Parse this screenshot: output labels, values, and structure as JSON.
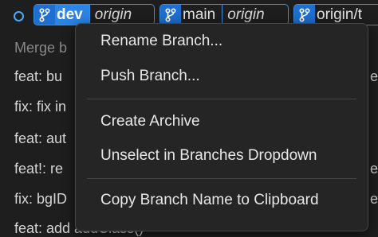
{
  "refs": [
    {
      "name": "dev",
      "remote": "origin"
    },
    {
      "name": "main",
      "remote": "origin"
    },
    {
      "name": "origin/t"
    }
  ],
  "commits": [
    {
      "message": "Merge b"
    },
    {
      "message": "feat: bu"
    },
    {
      "message": "fix: fix in"
    },
    {
      "message": "feat: aut"
    },
    {
      "message": "feat!: re"
    },
    {
      "message": "fix: bgID"
    },
    {
      "message": "feat: add addClass()"
    }
  ],
  "right_edge_chars": [
    "e",
    "e",
    "e"
  ],
  "context_menu": {
    "items": [
      {
        "label": "Rename Branch..."
      },
      {
        "label": "Push Branch..."
      },
      {
        "label": "Create Archive"
      },
      {
        "label": "Unselect in Branches Dropdown"
      },
      {
        "label": "Copy Branch Name to Clipboard"
      }
    ]
  },
  "colors": {
    "accent": "#2b84e6",
    "background": "#1e1e1e",
    "menu_background": "#252526"
  }
}
